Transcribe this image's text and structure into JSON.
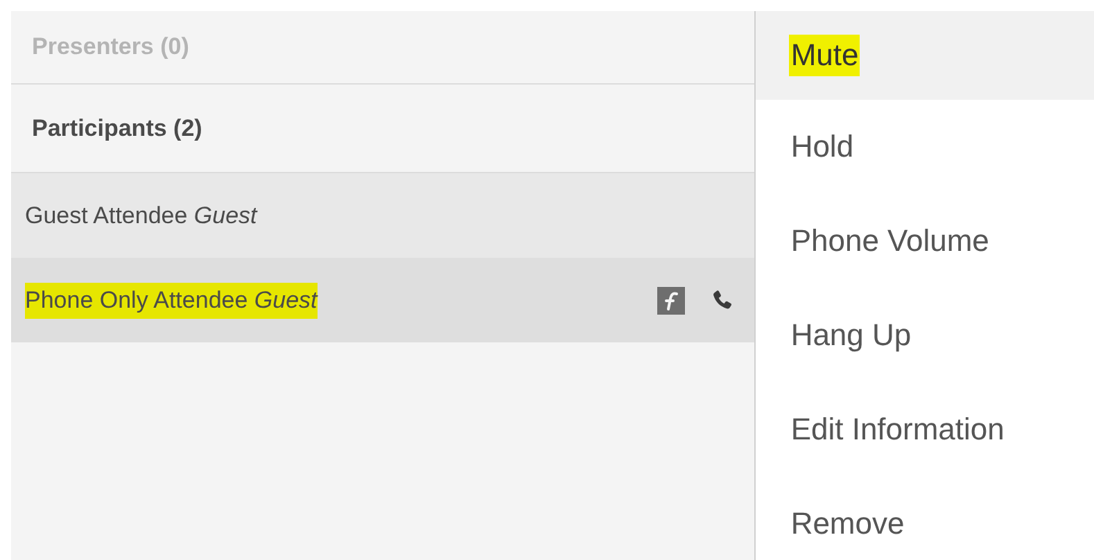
{
  "sections": [
    {
      "title": "Presenters (0)",
      "disabled": true
    },
    {
      "title": "Participants (2)",
      "disabled": false
    }
  ],
  "attendees": [
    {
      "name": "Guest Attendee",
      "role": "Guest",
      "selected": false,
      "highlighted": false
    },
    {
      "name": "Phone Only Attendee",
      "role": "Guest",
      "selected": true,
      "highlighted": true
    }
  ],
  "menu": [
    {
      "label": "Mute",
      "active": true,
      "highlighted": true
    },
    {
      "label": "Hold",
      "active": false,
      "highlighted": false
    },
    {
      "label": "Phone Volume",
      "active": false,
      "highlighted": false
    },
    {
      "label": "Hang Up",
      "active": false,
      "highlighted": false
    },
    {
      "label": "Edit Information",
      "active": false,
      "highlighted": false
    },
    {
      "label": "Remove",
      "active": false,
      "highlighted": false
    }
  ]
}
